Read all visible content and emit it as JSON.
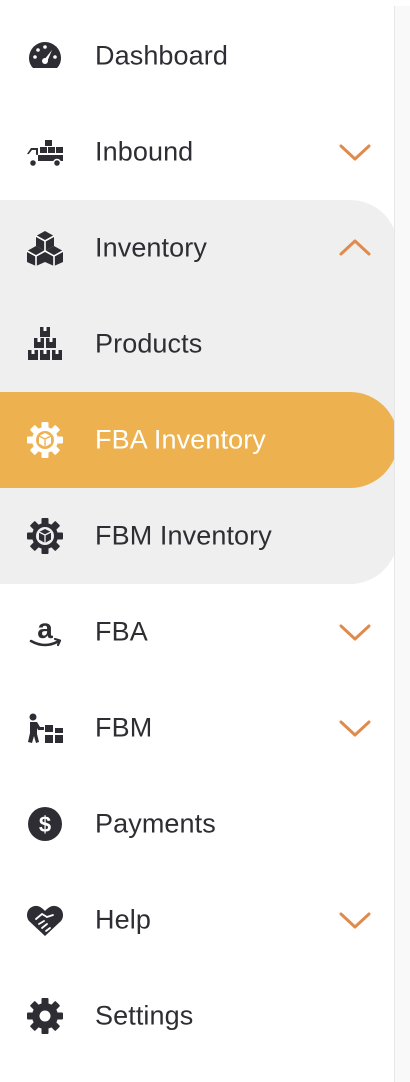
{
  "sidebar": {
    "items": [
      {
        "label": "Dashboard",
        "icon": "speedometer-icon"
      },
      {
        "label": "Inbound",
        "icon": "delivery-truck-icon",
        "chevron": "chevron-down"
      },
      {
        "label": "Inventory",
        "icon": "boxes-icon",
        "chevron": "chevron-up",
        "expanded": true
      },
      {
        "label": "Products",
        "icon": "stacked-boxes-icon",
        "submenu": true
      },
      {
        "label": "FBA Inventory",
        "icon": "gear-box-icon",
        "submenu": true,
        "active": true
      },
      {
        "label": "FBM Inventory",
        "icon": "gear-box-icon",
        "submenu": true
      },
      {
        "label": "FBA",
        "icon": "amazon-icon",
        "chevron": "chevron-down"
      },
      {
        "label": "FBM",
        "icon": "worker-boxes-icon",
        "chevron": "chevron-down"
      },
      {
        "label": "Payments",
        "icon": "dollar-icon"
      },
      {
        "label": "Help",
        "icon": "handshake-heart-icon",
        "chevron": "chevron-down"
      },
      {
        "label": "Settings",
        "icon": "gear-icon"
      }
    ]
  },
  "colors": {
    "active_bg": "#edb24f",
    "group_bg": "#efefef",
    "chevron": "#e08a4d",
    "text": "#2d2d33",
    "icon": "#2d2d33"
  }
}
